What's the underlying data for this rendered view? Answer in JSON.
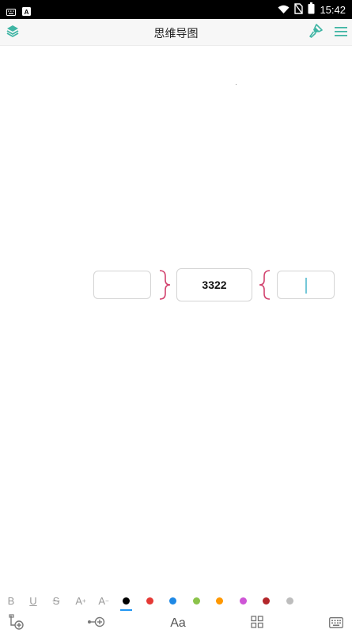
{
  "status_bar": {
    "time": "15:42",
    "icons": [
      "keyboard-icon",
      "a-badge-icon",
      "wifi-icon",
      "sim-off-icon",
      "battery-icon"
    ]
  },
  "app_bar": {
    "title": "思维导图",
    "left_icon": "layers-icon",
    "right_icons": [
      "brush-icon",
      "menu-icon"
    ],
    "accent_color": "#3fb5a4"
  },
  "mind_map": {
    "center_node": {
      "text": "3322"
    },
    "left_node": {
      "text": ""
    },
    "right_node": {
      "text": "",
      "editing": true
    },
    "brace_color": "#d2426e"
  },
  "format_bar": {
    "bold": "B",
    "underline": "U",
    "strike": "S",
    "increase_font": "A",
    "decrease_font": "A",
    "increase_sign": "+",
    "decrease_sign": "−",
    "colors": [
      "#000000",
      "#e53935",
      "#1e88e5",
      "#8bc34a",
      "#ff9800",
      "#ce55d6",
      "#b3262a",
      "#bdbdbd"
    ],
    "selected_color_index": 0
  },
  "bottom_toolbar": {
    "text_style_label": "Aa",
    "icons": [
      "add-child-node-icon",
      "add-sibling-node-icon",
      "text-style-icon",
      "layout-grid-icon",
      "keyboard-icon"
    ]
  }
}
